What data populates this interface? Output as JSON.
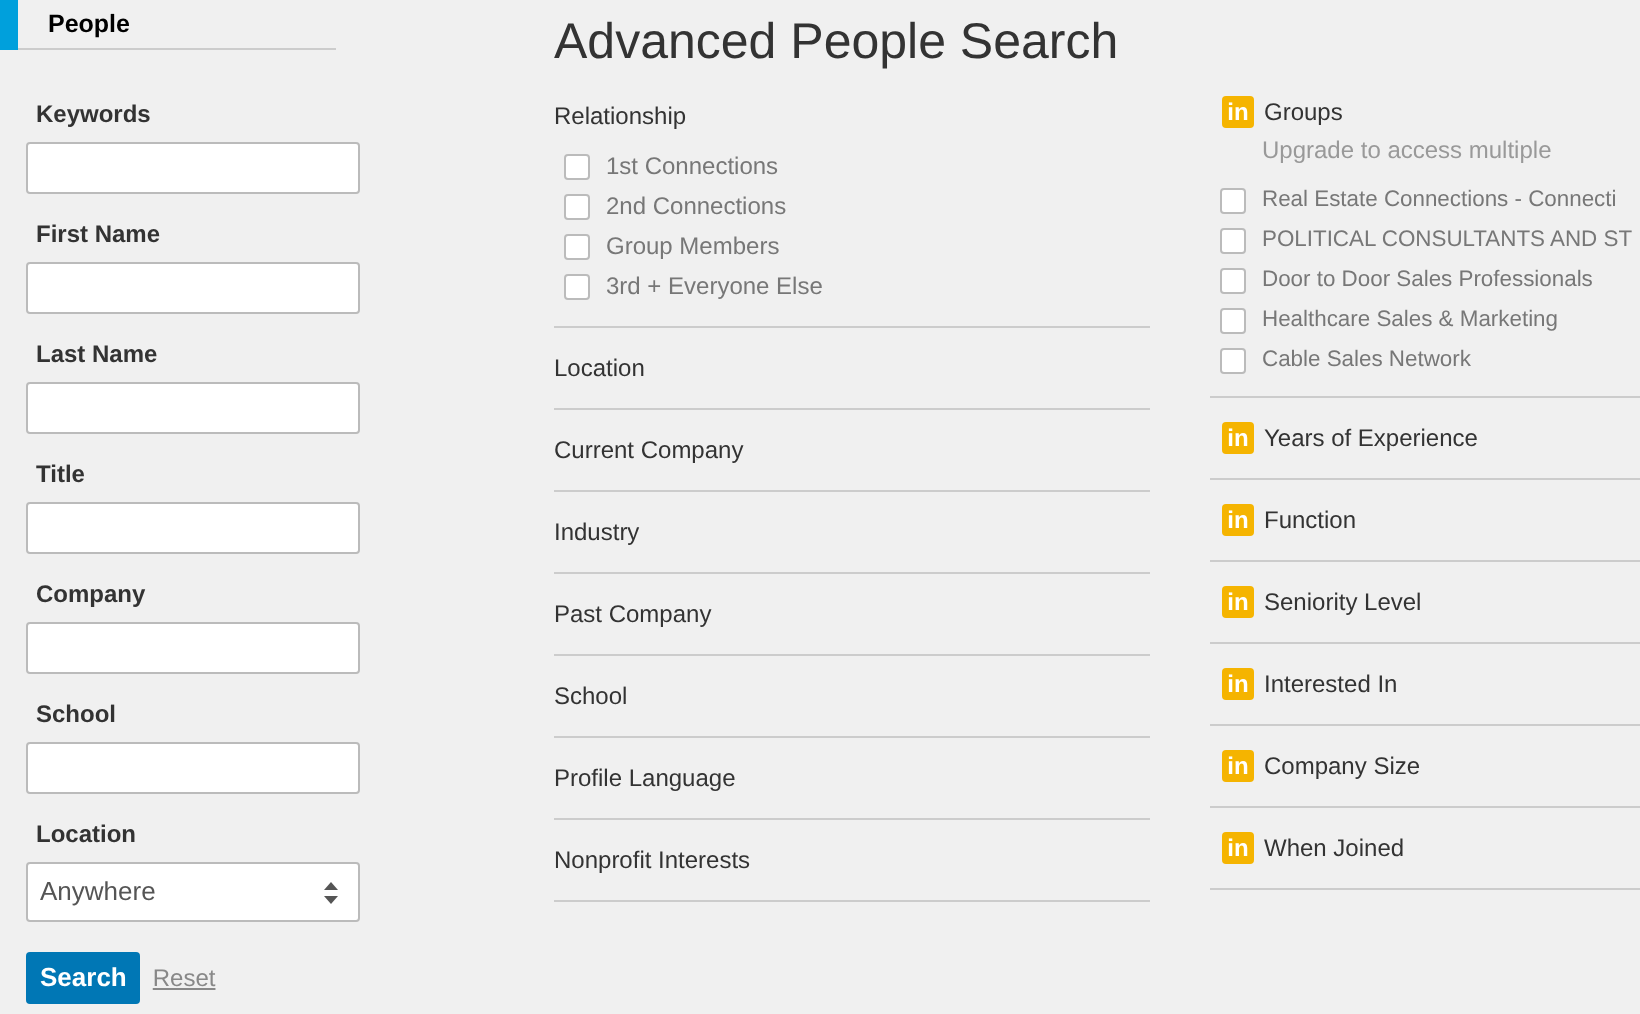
{
  "sidebar": {
    "tab": {
      "label": "People",
      "selected": true
    },
    "fields": [
      {
        "label": "Keywords",
        "kind": "text"
      },
      {
        "label": "First Name",
        "kind": "text"
      },
      {
        "label": "Last Name",
        "kind": "text"
      },
      {
        "label": "Title",
        "kind": "text"
      },
      {
        "label": "Company",
        "kind": "text"
      },
      {
        "label": "School",
        "kind": "text"
      },
      {
        "label": "Location",
        "kind": "select",
        "value": "Anywhere"
      }
    ],
    "search_button": "Search",
    "reset_link": "Reset"
  },
  "title": "Advanced People Search",
  "relationship": {
    "label": "Relationship",
    "options": [
      {
        "label": "1st Connections",
        "checked": false
      },
      {
        "label": "2nd Connections",
        "checked": false
      },
      {
        "label": "Group Members",
        "checked": false
      },
      {
        "label": "3rd + Everyone Else",
        "checked": false
      }
    ]
  },
  "facets": [
    "Location",
    "Current Company",
    "Industry",
    "Past Company",
    "School",
    "Profile Language",
    "Nonprofit Interests"
  ],
  "groups": {
    "badge": "in",
    "label": "Groups",
    "note": "Upgrade to access multiple",
    "options": [
      {
        "label": "Real Estate Connections - Connecti",
        "checked": false
      },
      {
        "label": "POLITICAL CONSULTANTS AND ST",
        "checked": false
      },
      {
        "label": "Door to Door Sales Professionals",
        "checked": false
      },
      {
        "label": "Healthcare Sales & Marketing",
        "checked": false
      },
      {
        "label": "Cable Sales Network",
        "checked": false
      }
    ]
  },
  "premium_facets": [
    {
      "badge": "in",
      "label": "Years of Experience"
    },
    {
      "badge": "in",
      "label": "Function"
    },
    {
      "badge": "in",
      "label": "Seniority Level"
    },
    {
      "badge": "in",
      "label": "Interested In"
    },
    {
      "badge": "in",
      "label": "Company Size"
    },
    {
      "badge": "in",
      "label": "When Joined"
    }
  ]
}
